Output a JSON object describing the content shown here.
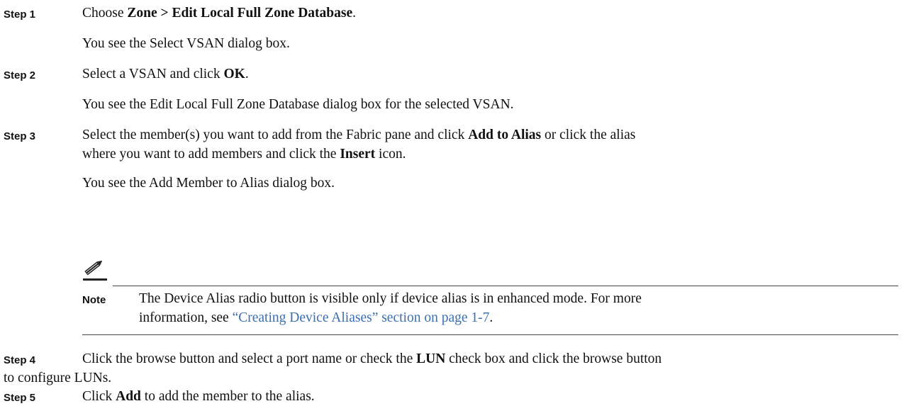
{
  "steps": [
    {
      "label": "Step 1",
      "instruction": {
        "pre": "Choose ",
        "b1": "Zone",
        "mid": " > ",
        "b2": "Edit Local Full Zone Database",
        "post": "."
      },
      "result": "You see the Select VSAN dialog box."
    },
    {
      "label": "Step 2",
      "instruction": {
        "pre": "Select a VSAN and click ",
        "b1": "OK",
        "post": "."
      },
      "result": "You see the Edit Local Full Zone Database dialog box for the selected VSAN."
    },
    {
      "label": "Step 3",
      "instruction": {
        "line1_pre": "Select the member(s) you want to add from the Fabric pane and click ",
        "line1_b": "Add to Alias",
        "line1_post": " or click the alias",
        "line2_pre": "where you want to add members and click the ",
        "line2_b": "Insert",
        "line2_post": " icon."
      },
      "result": "You see the Add Member to Alias dialog box."
    },
    {
      "label": "Step 4",
      "instruction": {
        "line1_pre": "Click the browse button and select a port name or check the ",
        "line1_b": "LUN",
        "line1_post": " check box and click the browse button",
        "line2": "to configure LUNs."
      }
    },
    {
      "label": "Step 5",
      "instruction": {
        "pre": "Click ",
        "b1": "Add",
        "post": " to add the member to the alias."
      }
    }
  ],
  "note": {
    "label": "Note",
    "icon": "pencil-note-icon",
    "line1": "The Device Alias radio button is visible only if device alias is in enhanced mode. For more",
    "line2_pre": "information, see ",
    "line2_link": "“Creating Device Aliases” section on page 1-7",
    "line2_post": "."
  },
  "colors": {
    "link": "#3a6fb0"
  }
}
